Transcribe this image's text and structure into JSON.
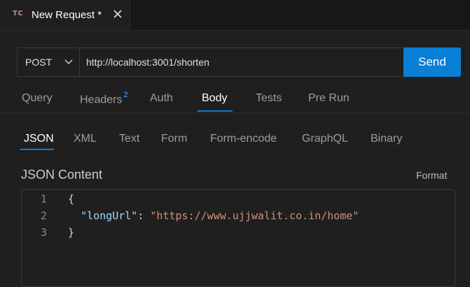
{
  "tab": {
    "icon_text": "TC",
    "title": "New Request *",
    "close_icon": "close-icon"
  },
  "request": {
    "method": "POST",
    "url": "http://localhost:3001/shorten",
    "send_label": "Send"
  },
  "section_tabs": [
    {
      "label": "Query"
    },
    {
      "label": "Headers",
      "badge": "2"
    },
    {
      "label": "Auth"
    },
    {
      "label": "Body",
      "active": true
    },
    {
      "label": "Tests"
    },
    {
      "label": "Pre Run"
    }
  ],
  "body_tabs": [
    {
      "label": "JSON",
      "active": true
    },
    {
      "label": "XML"
    },
    {
      "label": "Text"
    },
    {
      "label": "Form"
    },
    {
      "label": "Form-encode"
    },
    {
      "label": "GraphQL"
    },
    {
      "label": "Binary"
    }
  ],
  "content": {
    "title": "JSON Content",
    "format_label": "Format"
  },
  "editor": {
    "lines": [
      {
        "num": "1",
        "open": "{"
      },
      {
        "num": "2",
        "indent": "  ",
        "key": "\"longUrl\"",
        "colon": ": ",
        "value": "\"https://www.ujjwalit.co.in/home\""
      },
      {
        "num": "3",
        "close": "}"
      }
    ]
  },
  "colors": {
    "accent": "#0a7fd6",
    "tab_icon": "#c586c0",
    "json_key": "#9cdcfe",
    "json_string": "#ce9178"
  }
}
